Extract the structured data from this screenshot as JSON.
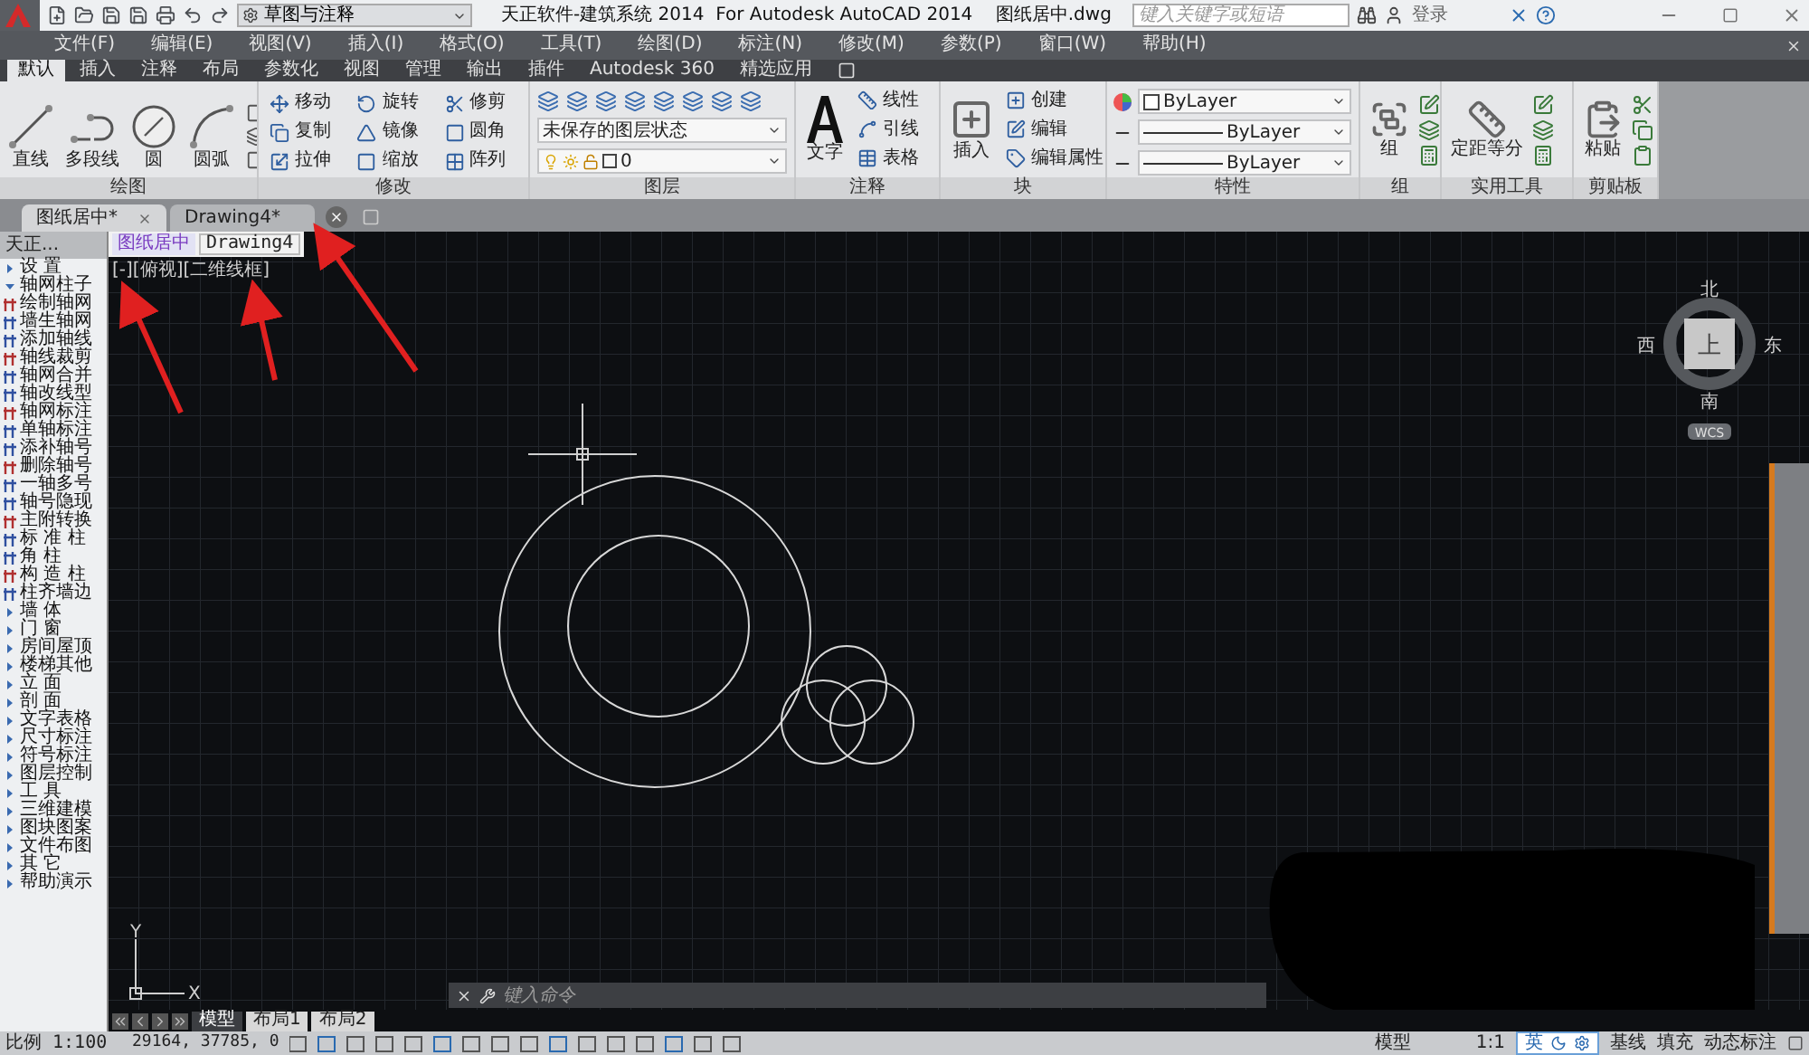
{
  "title_bar": {
    "workspace": "草图与注释",
    "title": "天正软件-建筑系统 2014  For Autodesk AutoCAD 2014    图纸居中.dwg",
    "search_placeholder": "键入关键字或短语",
    "login": "登录"
  },
  "menu": [
    "文件(F)",
    "编辑(E)",
    "视图(V)",
    "插入(I)",
    "格式(O)",
    "工具(T)",
    "绘图(D)",
    "标注(N)",
    "修改(M)",
    "参数(P)",
    "窗口(W)",
    "帮助(H)"
  ],
  "ribbon_tabs": [
    {
      "label": "默认",
      "selected": true
    },
    {
      "label": "插入",
      "selected": false
    },
    {
      "label": "注释",
      "selected": false
    },
    {
      "label": "布局",
      "selected": false
    },
    {
      "label": "参数化",
      "selected": false
    },
    {
      "label": "视图",
      "selected": false
    },
    {
      "label": "管理",
      "selected": false
    },
    {
      "label": "输出",
      "selected": false
    },
    {
      "label": "插件",
      "selected": false
    },
    {
      "label": "Autodesk 360",
      "selected": false
    },
    {
      "label": "精选应用",
      "selected": false
    }
  ],
  "ribbon_panels": [
    {
      "kind": "draw",
      "title": "绘图",
      "tools": [
        "直线",
        "多段线",
        "圆",
        "圆弧"
      ]
    },
    {
      "kind": "modify",
      "title": "修改",
      "tools": [
        "移动",
        "旋转",
        "修剪",
        "复制",
        "镜像",
        "圆角",
        "拉伸",
        "缩放",
        "阵列"
      ]
    },
    {
      "kind": "layer",
      "title": "图层",
      "state": "未保存的图层状态",
      "layer": "0"
    },
    {
      "kind": "annotation",
      "title": "注释",
      "large": "文字",
      "tools": [
        "线性",
        "引线",
        "表格"
      ]
    },
    {
      "kind": "block",
      "title": "块",
      "large": "插入",
      "tools": [
        "创建",
        "编辑",
        "编辑属性"
      ]
    },
    {
      "kind": "properties",
      "title": "特性",
      "values": [
        "ByLayer",
        "ByLayer",
        "ByLayer"
      ]
    },
    {
      "kind": "group",
      "title": "组",
      "large": "组"
    },
    {
      "kind": "utilities",
      "title": "实用工具",
      "large": "定距等分"
    },
    {
      "kind": "clipboard",
      "title": "剪贴板",
      "large": "粘贴"
    }
  ],
  "doc_tabs": [
    {
      "label": "图纸居中*",
      "selected": true
    },
    {
      "label": "Drawing4*",
      "selected": false
    }
  ],
  "sidebar": {
    "title": "天正...",
    "sections": [
      {
        "label": "设 置",
        "expanded": false
      },
      {
        "label": "轴网柱子",
        "expanded": true,
        "children": [
          "绘制轴网",
          "墙生轴网",
          "添加轴线",
          "轴线裁剪",
          "轴网合并",
          "轴改线型",
          "轴网标注",
          "单轴标注",
          "添补轴号",
          "删除轴号",
          "一轴多号",
          "轴号隐现",
          "主附转换",
          "标 准 柱",
          "角 柱",
          "构 造 柱",
          "柱齐墙边"
        ]
      },
      {
        "label": "墙 体",
        "expanded": false
      },
      {
        "label": "门 窗",
        "expanded": false
      },
      {
        "label": "房间屋顶",
        "expanded": false
      },
      {
        "label": "楼梯其他",
        "expanded": false
      },
      {
        "label": "立 面",
        "expanded": false
      },
      {
        "label": "剖 面",
        "expanded": false
      },
      {
        "label": "文字表格",
        "expanded": false
      },
      {
        "label": "尺寸标注",
        "expanded": false
      },
      {
        "label": "符号标注",
        "expanded": false
      },
      {
        "label": "图层控制",
        "expanded": false
      },
      {
        "label": "工 具",
        "expanded": false
      },
      {
        "label": "三维建模",
        "expanded": false
      },
      {
        "label": "图块图案",
        "expanded": false
      },
      {
        "label": "文件布图",
        "expanded": false
      },
      {
        "label": "其 它",
        "expanded": false
      },
      {
        "label": "帮助演示",
        "expanded": false
      }
    ]
  },
  "canvas": {
    "file_tabs": [
      {
        "label": "图纸居中",
        "selected": true
      },
      {
        "label": "Drawing4",
        "selected": false
      }
    ],
    "viewport_label": "[-][俯视][二维线框]",
    "viewcube": {
      "north": "北",
      "east": "东",
      "south": "南",
      "west": "西",
      "face": "上",
      "ucs": "WCS"
    },
    "ucs_x": "X",
    "ucs_y": "Y",
    "command_placeholder": "键入命令"
  },
  "layout_tabs": [
    {
      "label": "模型",
      "selected": true
    },
    {
      "label": "布局1",
      "selected": false
    },
    {
      "label": "布局2",
      "selected": false
    }
  ],
  "status_bar": {
    "scale": "比例 1:100",
    "coordinates": "29164, 37785, 0",
    "space": "模型",
    "annotation_scale": "1:1",
    "ime": "英",
    "toggles": [
      "基线",
      "填充",
      "动态标注"
    ]
  }
}
